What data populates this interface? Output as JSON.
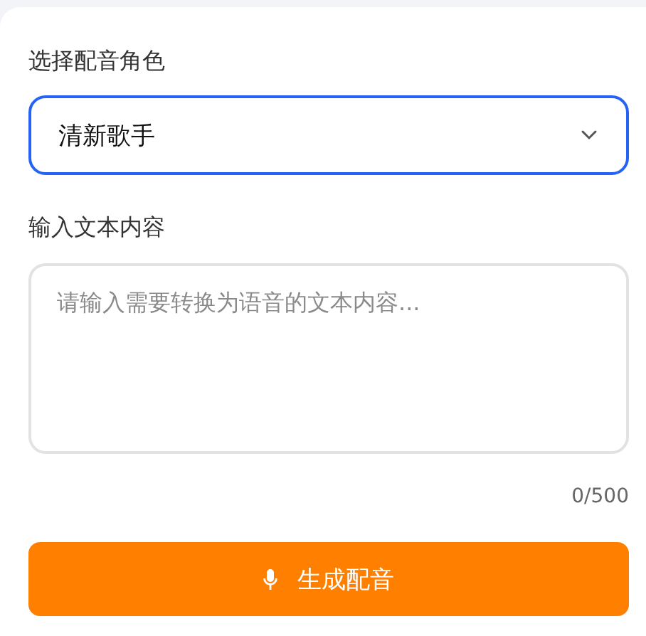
{
  "voice_select": {
    "label": "选择配音角色",
    "value": "清新歌手",
    "focused": true
  },
  "text_input": {
    "label": "输入文本内容",
    "placeholder": "请输入需要转换为语音的文本内容...",
    "counter": "0/500"
  },
  "generate_button": {
    "label": "生成配音"
  }
}
